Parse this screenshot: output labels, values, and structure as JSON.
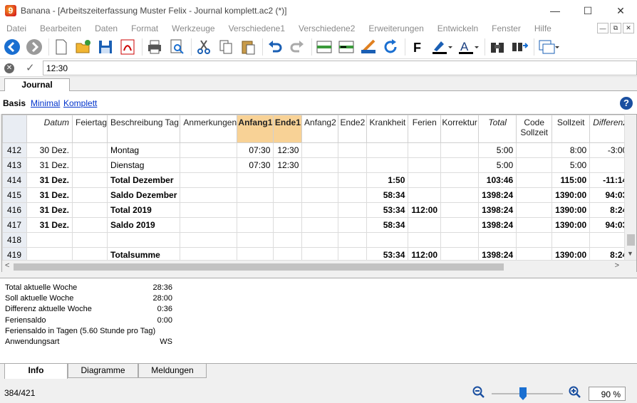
{
  "window": {
    "title": "Banana - [Arbeitszeiterfassung Muster Felix - Journal komplett.ac2 (*)]",
    "app_icon_letter": "9"
  },
  "menu": [
    "Datei",
    "Bearbeiten",
    "Daten",
    "Format",
    "Werkzeuge",
    "Verschiedene1",
    "Verschiedene2",
    "Erweiterungen",
    "Entwickeln",
    "Fenster",
    "Hilfe"
  ],
  "editbar": {
    "value": "12:30"
  },
  "doc_tab": "Journal",
  "views": {
    "active": "Basis",
    "links": [
      "Minimal",
      "Komplett"
    ]
  },
  "table": {
    "columns": [
      "Datum",
      "Feiertag",
      "Beschreibung Tag",
      "Anmerkungen",
      "Anfang1",
      "Ende1",
      "Anfang2",
      "Ende2",
      "Krankheit",
      "Ferien",
      "Korrektur",
      "Total",
      "Code Sollzeit",
      "Sollzeit",
      "Differenz"
    ],
    "rows": [
      {
        "n": "412",
        "datum": "30 Dez.",
        "besch": "Montag",
        "a1": "07:30",
        "e1": "12:30",
        "krank": "",
        "ferien": "",
        "total": "5:00",
        "soll": "8:00",
        "diff": "-3:00",
        "bold": false
      },
      {
        "n": "413",
        "datum": "31 Dez.",
        "besch": "Dienstag",
        "a1": "07:30",
        "e1": "12:30",
        "krank": "",
        "ferien": "",
        "total": "5:00",
        "soll": "5:00",
        "diff": "",
        "bold": false
      },
      {
        "n": "414",
        "datum": "31 Dez.",
        "besch": "Total Dezember",
        "a1": "",
        "e1": "",
        "krank": "1:50",
        "ferien": "",
        "total": "103:46",
        "soll": "115:00",
        "diff": "-11:14",
        "bold": true
      },
      {
        "n": "415",
        "datum": "31 Dez.",
        "besch": "Saldo Dezember",
        "a1": "",
        "e1": "",
        "krank": "58:34",
        "ferien": "",
        "total": "1398:24",
        "soll": "1390:00",
        "diff": "94:03",
        "bold": true
      },
      {
        "n": "416",
        "datum": "31 Dez.",
        "besch": "Total 2019",
        "a1": "",
        "e1": "",
        "krank": "53:34",
        "ferien": "112:00",
        "total": "1398:24",
        "soll": "1390:00",
        "diff": "8:24",
        "bold": true
      },
      {
        "n": "417",
        "datum": "31 Dez.",
        "besch": "Saldo 2019",
        "a1": "",
        "e1": "",
        "krank": "58:34",
        "ferien": "",
        "total": "1398:24",
        "soll": "1390:00",
        "diff": "94:03",
        "bold": true
      },
      {
        "n": "418",
        "datum": "",
        "besch": "",
        "a1": "",
        "e1": "",
        "krank": "",
        "ferien": "",
        "total": "",
        "soll": "",
        "diff": "",
        "bold": false
      },
      {
        "n": "419",
        "datum": "",
        "besch": "Totalsumme",
        "a1": "",
        "e1": "",
        "krank": "53:34",
        "ferien": "112:00",
        "total": "1398:24",
        "soll": "1390:00",
        "diff": "8:24",
        "bold": true
      }
    ]
  },
  "info": [
    {
      "label": "Total aktuelle Woche",
      "value": "28:36"
    },
    {
      "label": "Soll aktuelle Woche",
      "value": "28:00"
    },
    {
      "label": "Differenz aktuelle Woche",
      "value": "0:36"
    },
    {
      "label": "Feriensaldo",
      "value": "0:00"
    },
    {
      "label": "Feriensaldo in Tagen (5.60 Stunde pro Tag)",
      "value": ""
    },
    {
      "label": "Anwendungsart",
      "value": "WS"
    }
  ],
  "bottom_tabs": [
    "Info",
    "Diagramme",
    "Meldungen"
  ],
  "status": {
    "position": "384/421",
    "zoom": "90 %"
  }
}
